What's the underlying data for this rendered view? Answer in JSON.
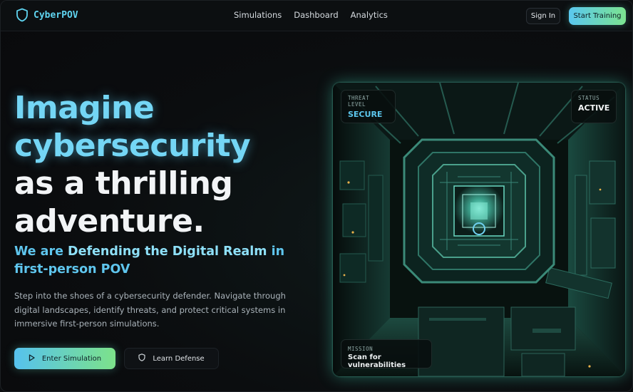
{
  "brand": {
    "name": "CyberPOV",
    "icon": "shield-icon",
    "accent": "#5fd4f0"
  },
  "nav": {
    "links": [
      {
        "label": "Simulations"
      },
      {
        "label": "Dashboard"
      },
      {
        "label": "Analytics"
      }
    ],
    "signin_label": "Sign In",
    "start_label": "Start Training"
  },
  "hero": {
    "headline": {
      "line1": "Imagine",
      "line2": "cybersecurity",
      "line3": "as a thrilling",
      "line4": "adventure."
    },
    "sub": {
      "prefix": "We are ",
      "highlight": "Defending the Digital Realm",
      "suffix": " in first-person POV"
    },
    "description": "Step into the shoes of a cybersecurity defender. Navigate through digital landscapes, identify threats, and protect critical systems in immersive first-person simulations.",
    "buttons": {
      "enter": {
        "label": "Enter Simulation",
        "icon": "play-icon"
      },
      "learn": {
        "label": "Learn Defense",
        "icon": "shield-icon"
      }
    }
  },
  "scene": {
    "threat": {
      "key": "THREAT LEVEL",
      "value": "SECURE"
    },
    "status": {
      "key": "STATUS",
      "value": "ACTIVE"
    },
    "mission": {
      "key": "MISSION",
      "value": "Scan for vulnerabilities"
    }
  },
  "colors": {
    "cyan": "#74d6f5",
    "green": "#7be38f",
    "background": "#0c0e10",
    "scene_glow": "#3cc8aa"
  }
}
